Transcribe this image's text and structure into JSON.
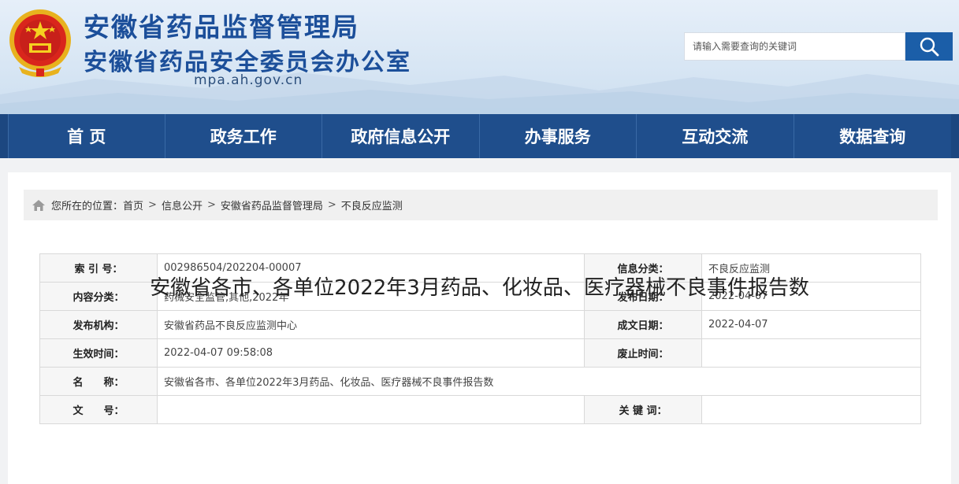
{
  "header": {
    "title_line1": "安徽省药品监督管理局",
    "title_line2": "安徽省药品安全委员会办公室",
    "domain": "mpa.ah.gov.cn",
    "search_placeholder": "请输入需要查询的关键词",
    "search_icon": "search-icon",
    "emblem_icon": "national-emblem-icon"
  },
  "nav": {
    "items": [
      {
        "label": "首 页"
      },
      {
        "label": "政务工作"
      },
      {
        "label": "政府信息公开"
      },
      {
        "label": "办事服务"
      },
      {
        "label": "互动交流"
      },
      {
        "label": "数据查询"
      }
    ]
  },
  "breadcrumb": {
    "home_icon": "home-icon",
    "prefix": "您所在的位置：",
    "items": [
      "首页",
      "信息公开",
      "安徽省药品监督管理局",
      "不良反应监测"
    ],
    "separator": ">"
  },
  "meta": {
    "index_label": "索 引 号：",
    "index_value": "002986504/202204-00007",
    "category_label": "信息分类：",
    "category_value": "不良反应监测",
    "content_label": "内容分类：",
    "content_value": "药械安全监管,其他,2022年",
    "pubdate_label": "发布日期：",
    "pubdate_value": "2022-04-07",
    "org_label": "发布机构：",
    "org_value": "安徽省药品不良反应监测中心",
    "docdate_label": "成文日期：",
    "docdate_value": "2022-04-07",
    "effective_label": "生效时间：",
    "effective_value": "2022-04-07 09:58:08",
    "expire_label": "废止时间：",
    "expire_value": "",
    "name_label": "名　　称：",
    "name_value": "安徽省各市、各单位2022年3月药品、化妆品、医疗器械不良事件报告数",
    "docno_label": "文　　号：",
    "docno_value": "",
    "keywords_label": "关 键 词：",
    "keywords_value": ""
  },
  "article": {
    "title": "安徽省各市、各单位2022年3月药品、化妆品、医疗器械不良事件报告数"
  },
  "colors": {
    "brand_blue": "#1c4f9a",
    "nav_bg": "#1f4e8c",
    "search_btn": "#1b5ea8"
  }
}
